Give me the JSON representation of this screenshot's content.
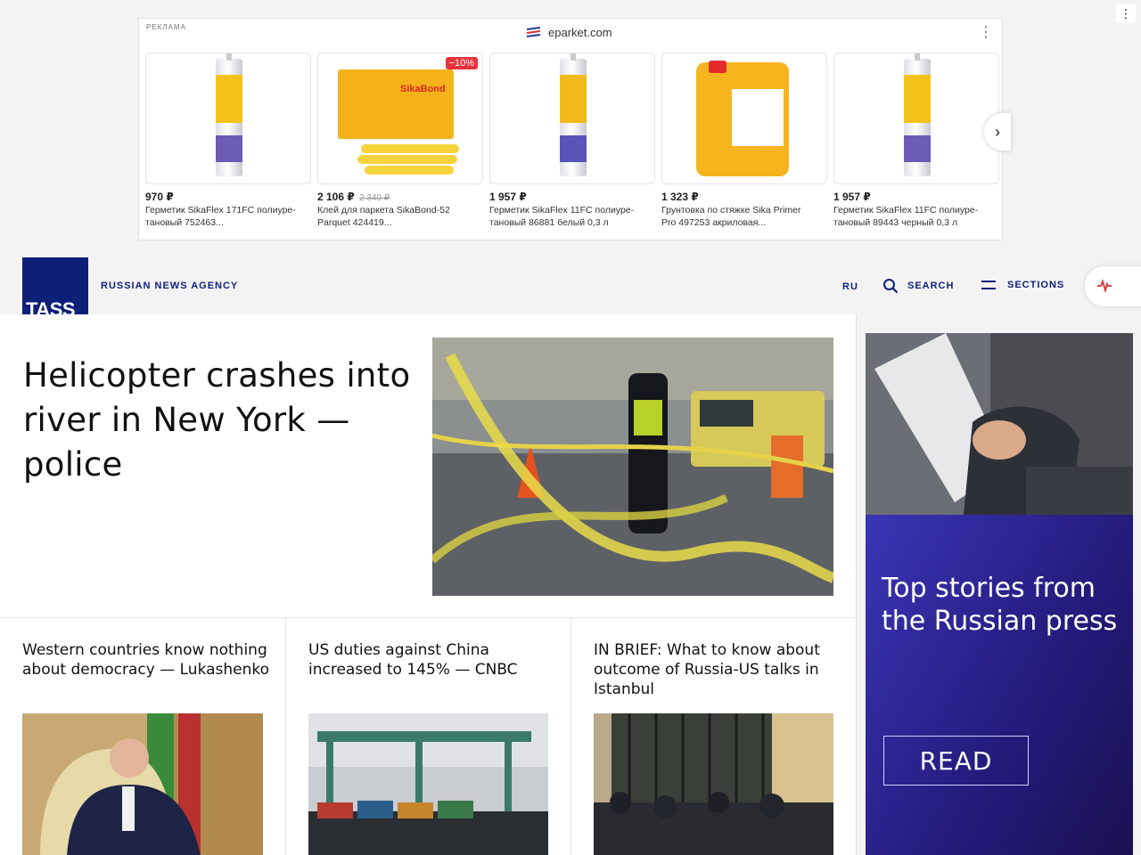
{
  "ad": {
    "label": "РЕКЛАМА",
    "source": "eparket.com",
    "menu_icon": "⋮",
    "next_icon": "›",
    "products": [
      {
        "price": "970 ₽",
        "old_price": "",
        "badge": "",
        "desc": "Герметик SikaFlex 171FC полиуре-\nтановый 752463..."
      },
      {
        "price": "2 106 ₽",
        "old_price": "2 340 ₽",
        "badge": "−10%",
        "desc": "Клей для паркета SikaBond-52\nParquet 424419..."
      },
      {
        "price": "1 957 ₽",
        "old_price": "",
        "badge": "",
        "desc": "Герметик SikaFlex 11FC полиуре-\nтановый 86881 белый 0,3 л"
      },
      {
        "price": "1 323 ₽",
        "old_price": "",
        "badge": "",
        "desc": "Грунтовка по стяжке Sika Primer\nPro 497253 акриловая..."
      },
      {
        "price": "1 957 ₽",
        "old_price": "",
        "badge": "",
        "desc": "Герметик SikaFlex 11FC полиуре-\nтановый 89443 черный 0,3 л"
      }
    ]
  },
  "header": {
    "logo": "TASS",
    "agency": "RUSSIAN NEWS AGENCY",
    "lang": "RU",
    "search": "SEARCH",
    "sections": "SECTIONS"
  },
  "hero": {
    "title": "Helicopter crashes into river in New York — police"
  },
  "cards": [
    {
      "title": "Western countries know nothing about democracy — Lukashenko"
    },
    {
      "title": "US duties against China increased to 145% — CNBC"
    },
    {
      "title": "IN BRIEF: What to know about outcome of Russia-US talks in Istanbul"
    }
  ],
  "side_ad": {
    "headline": "Top stories from the Russian press",
    "button": "READ"
  },
  "page_menu_icon": "⋮",
  "colors": {
    "brand_blue": "#0e1f7a",
    "badge_red": "#e8323c",
    "ad_purple": "#2a1f8f"
  }
}
